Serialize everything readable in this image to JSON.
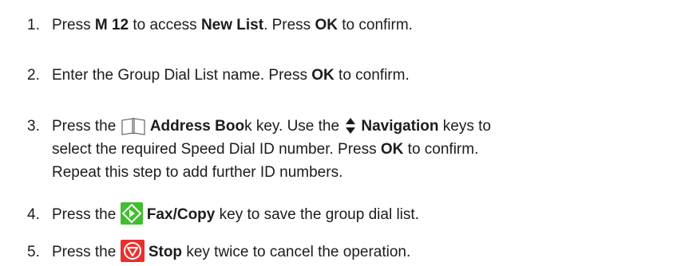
{
  "steps": [
    {
      "number": "1.",
      "t1": "Press ",
      "b1": "M 12",
      "t2": " to access ",
      "b2": "New List",
      "t3": ". Press ",
      "b3": "OK",
      "t4": " to confirm."
    },
    {
      "number": "2.",
      "t1": "Enter the Group Dial List name.  Press ",
      "b1": "OK",
      "t2": " to confirm."
    },
    {
      "number": "3.",
      "t1": "Press the ",
      "icon1": "address-book-icon",
      "b1": "Address Boo",
      "t2": "k key.  Use the ",
      "icon2": "up-down-arrows-icon",
      "b2": "Navigation",
      "t3": " keys to",
      "line2_t1": "select the required Speed Dial ID number. Press ",
      "line2_b1": "OK",
      "line2_t2": " to confirm.",
      "line3": "Repeat this step to add further ID numbers."
    },
    {
      "number": "4.",
      "t1": "Press the ",
      "icon1": "fax-copy-start-icon",
      "b1": "Fax/Copy",
      "t2": " key to save the group dial list."
    },
    {
      "number": "5.",
      "t1": "Press the ",
      "icon1": "stop-icon",
      "b1": "Stop",
      "t2": " key twice to cancel the operation."
    }
  ],
  "colors": {
    "text": "#1c1c1c",
    "start_key_green": "#3fbf2e",
    "stop_key_red": "#e8302c"
  }
}
